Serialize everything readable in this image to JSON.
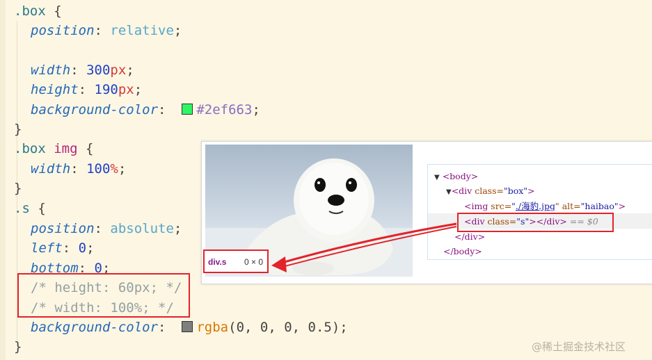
{
  "code_lines": {
    "l1": {
      "selector": ".box",
      "brace": " {"
    },
    "l2": {
      "prop": "position",
      "colon": ": ",
      "value": "relative",
      "semi": ";"
    },
    "l4": {
      "prop": "width",
      "colon": ": ",
      "num": "300",
      "unit": "px",
      "semi": ";"
    },
    "l5": {
      "prop": "height",
      "colon": ": ",
      "num": "190",
      "unit": "px",
      "semi": ";"
    },
    "l6": {
      "prop": "background-color",
      "colon": ":  ",
      "value": "#2ef663",
      "semi": ";",
      "swatch": "#2ef663"
    },
    "l7": {
      "brace": "}"
    },
    "l8": {
      "selector": ".box",
      "tag": "img",
      "brace": " {"
    },
    "l9": {
      "prop": "width",
      "colon": ": ",
      "num": "100",
      "unit": "%",
      "semi": ";"
    },
    "l10": {
      "brace": "}"
    },
    "l11": {
      "selector": ".s",
      "brace": " {"
    },
    "l12": {
      "prop": "position",
      "colon": ": ",
      "value": "absolute",
      "semi": ";"
    },
    "l13": {
      "prop": "left",
      "colon": ": ",
      "num": "0",
      "semi": ";"
    },
    "l14": {
      "prop": "bottom",
      "colon": ": ",
      "num": "0",
      "semi": ";"
    },
    "l15": {
      "comment": "/* height: 60px; */"
    },
    "l16": {
      "comment": "/* width: 100%; */"
    },
    "l17": {
      "prop": "background-color",
      "colon": ":  ",
      "fn": "rgba",
      "args": "(0, 0, 0, 0.5)",
      "semi": ";",
      "swatch": "#7f7f7f"
    },
    "l18": {
      "brace": "}"
    }
  },
  "tooltip": {
    "name": "div.s",
    "size": "0 × 0"
  },
  "devtools": {
    "body_open": "<body>",
    "div_box_open": "<div",
    "div_box_attr": " class=",
    "div_box_val": "\"box\"",
    "div_box_end": ">",
    "img_open": "<img",
    "img_src_attr": " src=",
    "img_src_q": "\"",
    "img_src_val": "./海豹.jpg",
    "img_alt_attr": "\" alt=",
    "img_alt_val": "\"haibao\"",
    "img_end": ">",
    "div_s_open": "<div",
    "div_s_attr": " class=",
    "div_s_val": "\"s\"",
    "div_s_end": "></div>",
    "div_s_eq": " == $0",
    "div_close": "</div>",
    "body_close": "</body>"
  },
  "watermark": "@稀土掘金技术社区",
  "colors": {
    "highlight_box": "#e2232a",
    "background": "#fdf6e3"
  }
}
